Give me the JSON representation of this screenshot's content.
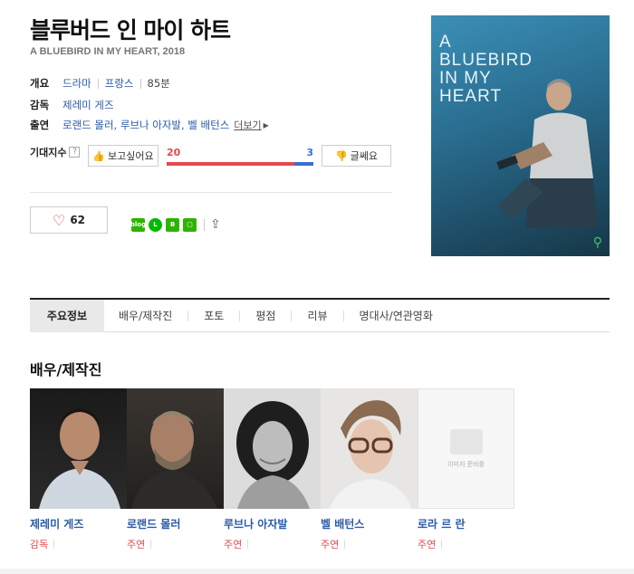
{
  "movie": {
    "title_ko": "블루버드 인 마이 하트",
    "title_en": "A BLUEBIRD IN MY HEART, 2018"
  },
  "info": {
    "overview_label": "개요",
    "genre": "드라마",
    "country": "프랑스",
    "runtime": "85분",
    "director_label": "감독",
    "director": "제레미 게즈",
    "cast_label": "출연",
    "cast_list": "로랜드 몰러, 루브나 아자발, 벨 배턴스",
    "more": "더보기"
  },
  "expect": {
    "label": "기대지수",
    "help": "?",
    "want_label": "보고싶어요",
    "want_count": "20",
    "meh_count": "3",
    "meh_label": "글쎄요",
    "want_ratio": 0.87
  },
  "like": {
    "count": "62"
  },
  "share_icons": [
    "blog-icon",
    "line-icon",
    "band-icon",
    "kakao-icon"
  ],
  "poster": {
    "title_lines": [
      "A",
      "BLUEBIRD",
      "IN MY",
      "HEART"
    ]
  },
  "tabs": [
    "주요정보",
    "배우/제작진",
    "포토",
    "평점",
    "리뷰",
    "명대사/연관영화"
  ],
  "cast_section": {
    "title": "배우/제작진",
    "people": [
      {
        "name": "제레미 게즈",
        "role": "감독"
      },
      {
        "name": "로랜드 몰러",
        "role": "주연"
      },
      {
        "name": "루브나 아자발",
        "role": "주연"
      },
      {
        "name": "벨 배턴스",
        "role": "주연"
      },
      {
        "name": "로라 르 란",
        "role": "주연"
      }
    ],
    "no_image_text": "이미지 준비중"
  },
  "colors": {
    "link": "#2b5aa8",
    "red": "#e5484d",
    "blue": "#3b6fd1"
  }
}
